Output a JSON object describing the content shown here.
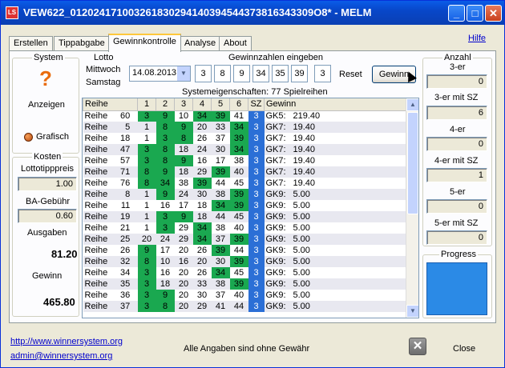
{
  "window": {
    "title": "VEW622_012024171003261830294140394544373816343309O8* - MELM",
    "app_icon": "LS"
  },
  "tabs": [
    "Erstellen",
    "Tippabgabe",
    "Gewinnkontrolle",
    "Analyse",
    "About"
  ],
  "help_link": "Hilfe",
  "system": {
    "label": "System",
    "show_label": "Anzeigen",
    "graph_label": "Grafisch"
  },
  "costs": {
    "label": "Kosten",
    "lotto_price_label": "Lottotipppreis",
    "lotto_price": "1.00",
    "ba_fee_label": "BA-Gebühr",
    "ba_fee": "0.60",
    "expenses_label": "Ausgaben",
    "expenses": "81.20",
    "win_label": "Gewinn",
    "win": "465.80"
  },
  "lotto": {
    "label": "Lotto",
    "mittwoch": "Mittwoch",
    "samstag": "Samstag",
    "date": "14.08.2013",
    "numbers_label": "Gewinnzahlen eingeben",
    "numbers": [
      "3",
      "8",
      "9",
      "34",
      "35",
      "39"
    ],
    "sz": "3",
    "reset_label": "Reset",
    "gewinn_btn": "Gewinn"
  },
  "grid": {
    "title": "Systemeigenschaften: 77 Spielreihen",
    "headers": [
      "Reihe",
      "1",
      "2",
      "3",
      "4",
      "5",
      "6",
      "SZ",
      "Gewinn"
    ],
    "rows": [
      [
        "Reihe",
        "60",
        "3",
        "9",
        "10",
        "34",
        "39",
        "41",
        "3",
        "GK5:",
        "219.40"
      ],
      [
        "Reihe",
        "5",
        "1",
        "8",
        "9",
        "20",
        "33",
        "34",
        "3",
        "GK7:",
        "19.40"
      ],
      [
        "Reihe",
        "18",
        "1",
        "3",
        "8",
        "26",
        "37",
        "39",
        "3",
        "GK7:",
        "19.40"
      ],
      [
        "Reihe",
        "47",
        "3",
        "8",
        "18",
        "24",
        "30",
        "34",
        "3",
        "GK7:",
        "19.40"
      ],
      [
        "Reihe",
        "57",
        "3",
        "8",
        "9",
        "16",
        "17",
        "38",
        "3",
        "GK7:",
        "19.40"
      ],
      [
        "Reihe",
        "71",
        "8",
        "9",
        "18",
        "29",
        "39",
        "40",
        "3",
        "GK7:",
        "19.40"
      ],
      [
        "Reihe",
        "76",
        "8",
        "34",
        "38",
        "39",
        "44",
        "45",
        "3",
        "GK7:",
        "19.40"
      ],
      [
        "Reihe",
        "8",
        "1",
        "9",
        "24",
        "30",
        "38",
        "39",
        "3",
        "GK9:",
        "5.00"
      ],
      [
        "Reihe",
        "11",
        "1",
        "16",
        "17",
        "18",
        "34",
        "39",
        "3",
        "GK9:",
        "5.00"
      ],
      [
        "Reihe",
        "19",
        "1",
        "3",
        "9",
        "18",
        "44",
        "45",
        "3",
        "GK9:",
        "5.00"
      ],
      [
        "Reihe",
        "21",
        "1",
        "3",
        "29",
        "34",
        "38",
        "40",
        "3",
        "GK9:",
        "5.00"
      ],
      [
        "Reihe",
        "25",
        "20",
        "24",
        "29",
        "34",
        "37",
        "39",
        "3",
        "GK9:",
        "5.00"
      ],
      [
        "Reihe",
        "26",
        "9",
        "17",
        "20",
        "26",
        "39",
        "44",
        "3",
        "GK9:",
        "5.00"
      ],
      [
        "Reihe",
        "32",
        "8",
        "10",
        "16",
        "20",
        "30",
        "39",
        "3",
        "GK9:",
        "5.00"
      ],
      [
        "Reihe",
        "34",
        "3",
        "16",
        "20",
        "26",
        "34",
        "45",
        "3",
        "GK9:",
        "5.00"
      ],
      [
        "Reihe",
        "35",
        "3",
        "18",
        "20",
        "33",
        "38",
        "39",
        "3",
        "GK9:",
        "5.00"
      ],
      [
        "Reihe",
        "36",
        "3",
        "9",
        "20",
        "30",
        "37",
        "40",
        "3",
        "GK9:",
        "5.00"
      ],
      [
        "Reihe",
        "37",
        "3",
        "8",
        "20",
        "29",
        "41",
        "44",
        "3",
        "GK9:",
        "5.00"
      ]
    ]
  },
  "anzahl": {
    "label": "Anzahl",
    "items": [
      {
        "label": "3-er",
        "value": "0"
      },
      {
        "label": "3-er mit SZ",
        "value": "6"
      },
      {
        "label": "4-er",
        "value": "0"
      },
      {
        "label": "4-er mit SZ",
        "value": "1"
      },
      {
        "label": "5-er",
        "value": "0"
      },
      {
        "label": "5-er mit SZ",
        "value": "0"
      }
    ],
    "progress_label": "Progress"
  },
  "footer": {
    "url": "http://www.winnersystem.org",
    "email": "admin@winnersystem.org",
    "disclaimer": "Alle Angaben sind ohne Gewähr",
    "close_label": "Close"
  },
  "colors": {
    "hit": "#1aa850",
    "sz": "#2b6fd6",
    "progress": "#2b8ae6"
  }
}
